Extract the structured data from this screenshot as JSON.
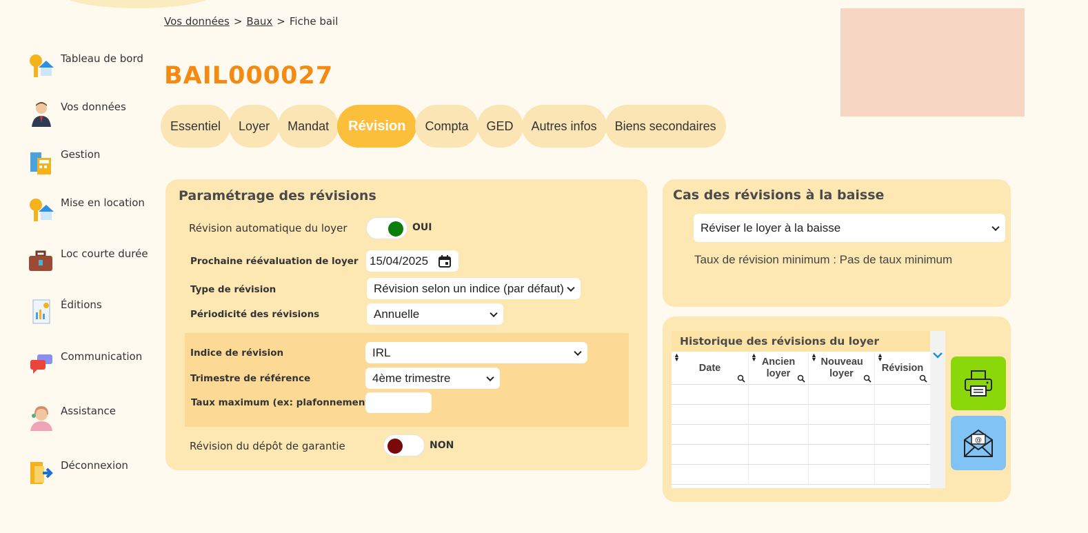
{
  "breadcrumb": {
    "item1": "Vos données",
    "sep1": ">",
    "item2": "Baux",
    "sep2": ">",
    "current": "Fiche bail"
  },
  "page_title": "BAIL000027",
  "sidebar": {
    "items": [
      {
        "label": "Tableau de bord",
        "icon": "house-key-icon"
      },
      {
        "label": "Vos données",
        "icon": "user-icon"
      },
      {
        "label": "Gestion",
        "icon": "calculator-icon"
      },
      {
        "label": "Mise en location",
        "icon": "house-key-icon"
      },
      {
        "label": "Loc courte durée",
        "icon": "suitcase-icon"
      },
      {
        "label": "Éditions",
        "icon": "report-icon"
      },
      {
        "label": "Communication",
        "icon": "chat-icon"
      },
      {
        "label": "Assistance",
        "icon": "support-agent-icon"
      },
      {
        "label": "Déconnexion",
        "icon": "logout-icon"
      }
    ]
  },
  "tabs": [
    {
      "label": "Essentiel"
    },
    {
      "label": "Loyer"
    },
    {
      "label": "Mandat"
    },
    {
      "label": "Révision",
      "active": true
    },
    {
      "label": "Compta"
    },
    {
      "label": "GED"
    },
    {
      "label": "Autres infos"
    },
    {
      "label": "Biens secondaires"
    }
  ],
  "revision_settings": {
    "title": "Paramétrage des révisions",
    "auto_revision_label": "Révision automatique du loyer",
    "auto_revision_state": "OUI",
    "next_reeval_label": "Prochaine réévaluation de loyer",
    "next_reeval_value": "15/04/2025",
    "type_label": "Type de révision",
    "type_value": "Révision selon un indice (par défaut)",
    "periodicity_label": "Périodicité des révisions",
    "periodicity_value": "Annuelle",
    "index_label": "Indice de révision",
    "index_value": "IRL",
    "quarter_label": "Trimestre de référence",
    "quarter_value": "4ème trimestre",
    "max_rate_label": "Taux maximum (ex: plafonnement)",
    "max_rate_value": "",
    "deposit_label": "Révision du dépôt de garantie",
    "deposit_state": "NON"
  },
  "downward": {
    "title": "Cas des révisions à la baisse",
    "select_value": "Réviser le loyer à la baisse",
    "min_rate_text": "Taux de révision minimum : Pas de taux minimum"
  },
  "history": {
    "title": "Historique des révisions du loyer",
    "columns": [
      "Date",
      "Ancien loyer",
      "Nouveau loyer",
      "Révision"
    ],
    "rows": []
  },
  "colors": {
    "accent_orange": "#f48a12",
    "active_tab": "#fcbf3b",
    "panel_bg": "#fde8b3",
    "toggle_on": "#0a7d0a",
    "toggle_off": "#7a0a0a",
    "print_button": "#8ad80a",
    "email_button": "#82c3f5"
  }
}
